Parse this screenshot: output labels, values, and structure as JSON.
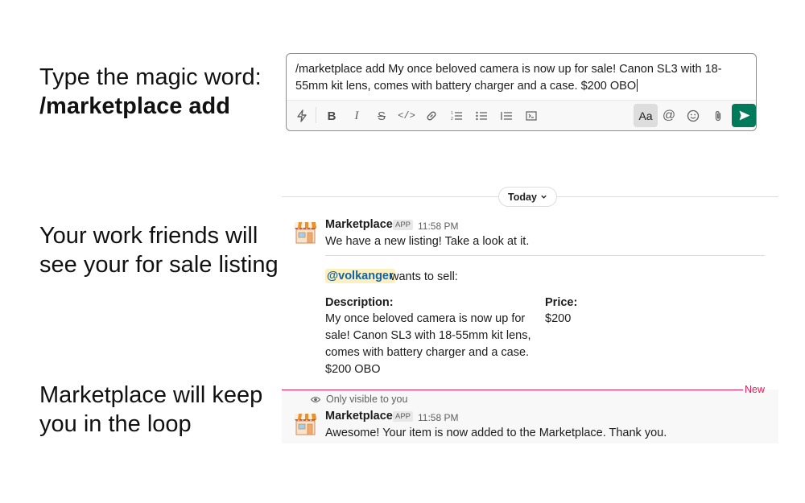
{
  "captions": {
    "step1_line1": "Type the magic word:",
    "step1_command": "/marketplace add",
    "step2_line1": "Your work friends will",
    "step2_line2": "see your for sale listing",
    "step3_line1": "Marketplace will keep",
    "step3_line2": "you in the loop"
  },
  "composer": {
    "value": "/marketplace add My once beloved camera is now up for sale! Canon SL3 with 18-55mm kit lens, comes with battery charger and a case. $200 OBO",
    "toolbar": {
      "icons": [
        "shortcuts-icon",
        "bold-icon",
        "italic-icon",
        "strikethrough-icon",
        "code-icon",
        "link-icon",
        "ordered-list-icon",
        "bulleted-list-icon",
        "blockquote-icon",
        "code-block-icon",
        "formatting-toggle",
        "mention-icon",
        "emoji-icon",
        "attach-icon",
        "send-icon"
      ],
      "format_label": "Aa",
      "send_color": "#007a5a"
    }
  },
  "divider": {
    "label": "Today"
  },
  "messages": [
    {
      "sender": "Marketplace",
      "badge": "APP",
      "time": "11:58 PM",
      "text": "We have a new listing! Take a look at it.",
      "mention": "@volkanger",
      "mention_suffix": "wants to sell:",
      "fields": {
        "description_label": "Description:",
        "description_lines": [
          "My once beloved camera is now up for",
          "sale! Canon SL3 with 18-55mm kit lens,",
          "comes with battery charger and a case.",
          "$200 OBO"
        ],
        "price_label": "Price:",
        "price_value": "$200"
      }
    },
    {
      "new_label": "New",
      "visibility": "Only visible to you",
      "sender": "Marketplace",
      "badge": "APP",
      "time": "11:58 PM",
      "text": "Awesome! Your item is now added to the Marketplace. Thank you."
    }
  ],
  "colors": {
    "accent_send": "#007a5a",
    "new_line": "#e01e5a",
    "mention_bg": "#fcefc0",
    "mention_text": "#1264a3"
  }
}
